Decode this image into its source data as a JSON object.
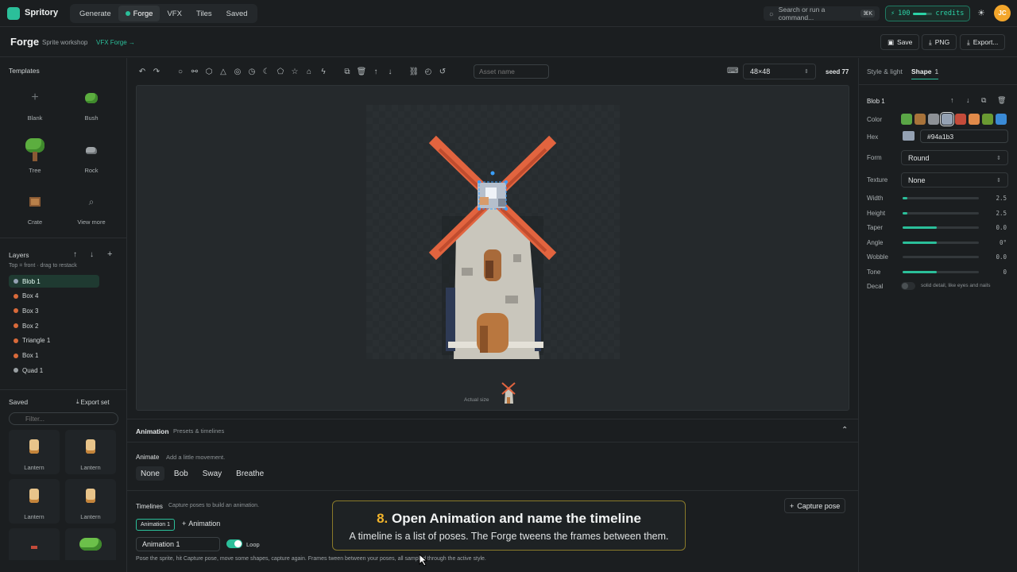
{
  "topbar": {
    "brand": "Spritory",
    "nav": [
      "Generate",
      "Forge",
      "VFX",
      "Tiles",
      "Saved"
    ],
    "active_nav": "Forge",
    "search_placeholder": "Search or run a command...",
    "search_shortcut": "⌘K",
    "credits_value": "100",
    "credits_label": "credits",
    "credits_fill": 0.7,
    "avatar_initials": "JC"
  },
  "subheader": {
    "title": "Forge",
    "subtitle": "Sprite workshop",
    "link": "VFX Forge →",
    "save_label": "Save",
    "png_label": "PNG",
    "export_label": "Export..."
  },
  "templates": {
    "title": "Templates",
    "items": [
      {
        "label": "Blank",
        "icon": "plus-icon"
      },
      {
        "label": "Bush",
        "icon": "bush-icon"
      },
      {
        "label": "Tree",
        "icon": "tree-icon"
      },
      {
        "label": "Rock",
        "icon": "rock-icon"
      },
      {
        "label": "Crate",
        "icon": "crate-icon"
      },
      {
        "label": "View more",
        "icon": "search-icon"
      }
    ]
  },
  "layers": {
    "title": "Layers",
    "hint": "Top = front · drag to restack",
    "items": [
      {
        "label": "Blob 1",
        "color": "#94a1b3",
        "active": true
      },
      {
        "label": "Box 4",
        "color": "#d96a3a"
      },
      {
        "label": "Box 3",
        "color": "#d96a3a"
      },
      {
        "label": "Box 2",
        "color": "#d96a3a"
      },
      {
        "label": "Triangle 1",
        "color": "#d96a3a"
      },
      {
        "label": "Box 1",
        "color": "#d96a3a"
      },
      {
        "label": "Quad 1",
        "color": "#9aa0a3"
      }
    ]
  },
  "saved": {
    "title": "Saved",
    "export_label": "Export set",
    "filter_placeholder": "Filter...",
    "items": [
      "Lantern",
      "Lantern",
      "Lantern",
      "Lantern"
    ]
  },
  "toolbar": {
    "asset_placeholder": "Asset name",
    "size_value": "48×48",
    "seed_label": "seed 77"
  },
  "canvas": {
    "actual_size_label": "Actual size"
  },
  "rightpanel": {
    "tab_style": "Style & light",
    "tab_shape": "Shape",
    "tab_shape_count": "1",
    "shape_title": "Blob 1",
    "color_label": "Color",
    "swatches": [
      "#5aa646",
      "#a8733a",
      "#8d9196",
      "#94a1b3",
      "#c44b3a",
      "#e08a4a",
      "#6a9a32",
      "#3a8ad6"
    ],
    "selected_swatch": 3,
    "hex_label": "Hex",
    "hex_value": "#94a1b3",
    "form_label": "Form",
    "form_value": "Round",
    "texture_label": "Texture",
    "texture_value": "None",
    "sliders": [
      {
        "label": "Width",
        "value": "2.5",
        "fill": 0.06
      },
      {
        "label": "Height",
        "value": "2.5",
        "fill": 0.06
      },
      {
        "label": "Taper",
        "value": "0.0",
        "fill": 0.45
      },
      {
        "label": "Angle",
        "value": "0°",
        "fill": 0.45
      },
      {
        "label": "Wobble",
        "value": "0.0",
        "fill": 0.0
      },
      {
        "label": "Tone",
        "value": "0",
        "fill": 0.45
      }
    ],
    "decal_label": "Decal",
    "decal_hint": "solid detail, like eyes and nails"
  },
  "animation": {
    "title": "Animation",
    "subtitle": "Presets & timelines",
    "animate_label": "Animate",
    "animate_hint": "Add a little movement.",
    "presets": [
      "None",
      "Bob",
      "Sway",
      "Breathe"
    ],
    "active_preset": "None",
    "timelines_label": "Timelines",
    "timelines_hint": "Capture poses to build an animation.",
    "capture_label": "Capture pose",
    "timeline_chip": "Animation 1",
    "add_animation_label": "Animation",
    "timeline_name_value": "Animation 1",
    "loop_label": "Loop",
    "footer_hint": "Pose the sprite, hit Capture pose, move some shapes, capture again. Frames tween between your poses, all sampled through the active style."
  },
  "tip": {
    "number": "8.",
    "title": "Open Animation and name the timeline",
    "body": "A timeline is a list of poses. The Forge tweens the frames between them."
  }
}
